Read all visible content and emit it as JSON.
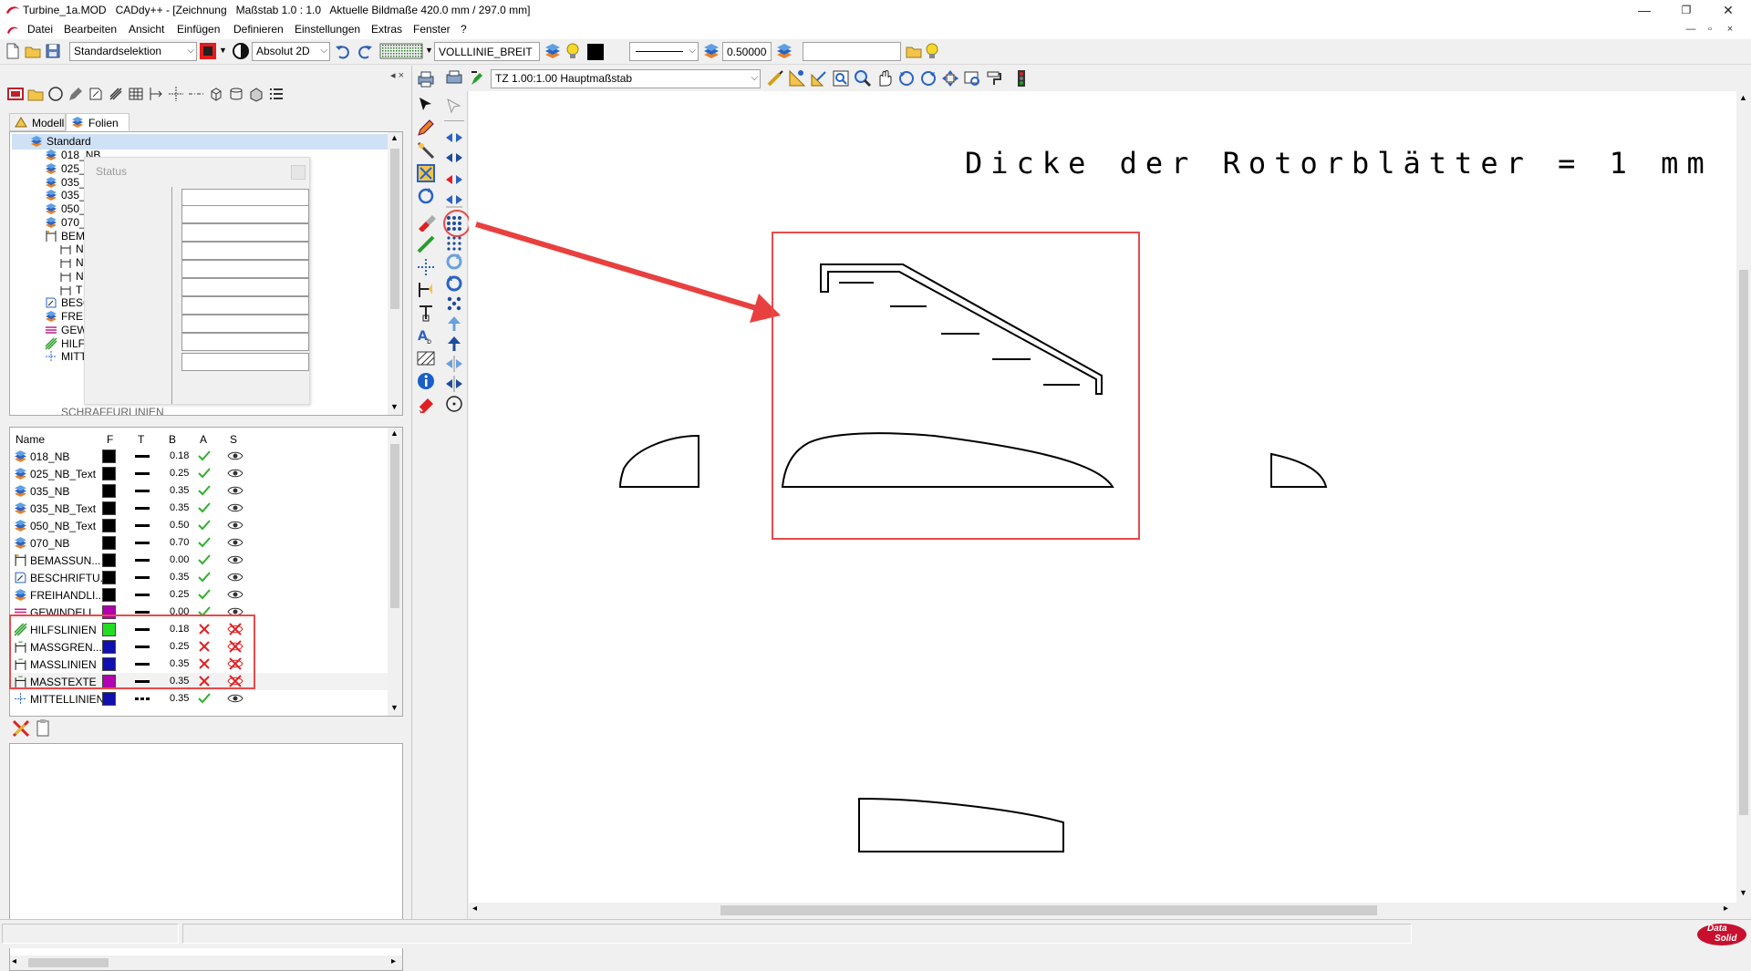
{
  "window": {
    "title": "Turbine_1a.MOD   CADdy++ - [Zeichnung   Maßstab 1.0 : 1.0   Aktuelle Bildmaße 420.0 mm / 297.0 mm]",
    "controls": {
      "minimize": "—",
      "maximize": "❐",
      "close": "✕"
    }
  },
  "menu": {
    "items": [
      "Datei",
      "Bearbeiten",
      "Ansicht",
      "Einfügen",
      "Definieren",
      "Einstellungen",
      "Extras",
      "Fenster",
      "?"
    ],
    "mdi_controls": [
      "—",
      "▫",
      "×"
    ]
  },
  "toolbar": {
    "selection_mode": "Standardselektion",
    "coord_mode": "Absolut 2D",
    "line_style_name": "VOLLLINIE_BREIT",
    "line_width": "0.500000",
    "search_value": ""
  },
  "drawing_toolbar": {
    "scale_combo": "TZ 1.00:1.00 Hauptmaßstab"
  },
  "side_tabs": [
    "Modell",
    "Folien"
  ],
  "tree": {
    "root": "Standard",
    "items": [
      "018_NB",
      "025_I",
      "035_I",
      "035_I",
      "050_I",
      "070_I",
      "BEM",
      "N",
      "N",
      "N",
      "T",
      "BESC",
      "FREI",
      "GEW",
      "HILF",
      "MITT"
    ],
    "partial_bottom": "SCHRAFFURLINIEN"
  },
  "status_popup": {
    "caption": "Status"
  },
  "layers": {
    "headers": [
      "Name",
      "F",
      "T",
      "B",
      "A",
      "S"
    ],
    "rows": [
      {
        "name": "018_NB",
        "color": "#000000",
        "width": "0.18",
        "active": true,
        "visible": true
      },
      {
        "name": "025_NB_Text",
        "color": "#000000",
        "width": "0.25",
        "active": true,
        "visible": true
      },
      {
        "name": "035_NB",
        "color": "#000000",
        "width": "0.35",
        "active": true,
        "visible": true
      },
      {
        "name": "035_NB_Text",
        "color": "#000000",
        "width": "0.35",
        "active": true,
        "visible": true
      },
      {
        "name": "050_NB_Text",
        "color": "#000000",
        "width": "0.50",
        "active": true,
        "visible": true
      },
      {
        "name": "070_NB",
        "color": "#000000",
        "width": "0.70",
        "active": true,
        "visible": true
      },
      {
        "name": "BEMASSUN...",
        "color": "#000000",
        "width": "0.00",
        "active": true,
        "visible": true
      },
      {
        "name": "BESCHRIFTU...",
        "color": "#000000",
        "width": "0.35",
        "active": true,
        "visible": true
      },
      {
        "name": "FREIHANDLI...",
        "color": "#000000",
        "width": "0.25",
        "active": true,
        "visible": true
      },
      {
        "name": "GEWINDELI...",
        "color": "#b000b0",
        "width": "0.00",
        "active": true,
        "visible": true
      },
      {
        "name": "HILFSLINIEN",
        "color": "#22dd22",
        "width": "0.18",
        "active": false,
        "visible": false
      },
      {
        "name": "MASSGREN...",
        "color": "#1010b0",
        "width": "0.25",
        "active": false,
        "visible": false
      },
      {
        "name": "MASSLINIEN",
        "color": "#1010b0",
        "width": "0.35",
        "active": false,
        "visible": false
      },
      {
        "name": "MASSTEXTE",
        "color": "#b000b0",
        "width": "0.35",
        "active": false,
        "visible": false
      },
      {
        "name": "MITTELLINIEN",
        "color": "#1010b0",
        "width": "0.35",
        "active": true,
        "visible": true
      }
    ]
  },
  "canvas": {
    "annotation": "Dicke der Rotorblätter = 1 mm"
  },
  "colors": {
    "highlight": "#e84a4a",
    "arrow": "#e8403f",
    "check": "#2fb02f",
    "cross": "#e02020",
    "brand": "#c8102e"
  },
  "statusbar": {
    "logo_line1": "Data",
    "logo_line2": "Solid"
  }
}
